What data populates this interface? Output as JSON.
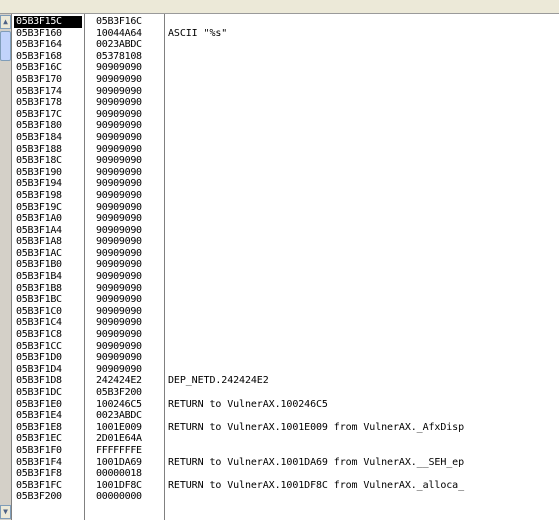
{
  "stack": {
    "rows": [
      {
        "addr": "05B3F15C",
        "val": "05B3F16C",
        "comment": "",
        "selected": true
      },
      {
        "addr": "05B3F160",
        "val": "10044A64",
        "comment": "ASCII \"%s\""
      },
      {
        "addr": "05B3F164",
        "val": "0023ABDC",
        "comment": ""
      },
      {
        "addr": "05B3F168",
        "val": "05378108",
        "comment": ""
      },
      {
        "addr": "05B3F16C",
        "val": "90909090",
        "comment": ""
      },
      {
        "addr": "05B3F170",
        "val": "90909090",
        "comment": ""
      },
      {
        "addr": "05B3F174",
        "val": "90909090",
        "comment": ""
      },
      {
        "addr": "05B3F178",
        "val": "90909090",
        "comment": ""
      },
      {
        "addr": "05B3F17C",
        "val": "90909090",
        "comment": ""
      },
      {
        "addr": "05B3F180",
        "val": "90909090",
        "comment": ""
      },
      {
        "addr": "05B3F184",
        "val": "90909090",
        "comment": ""
      },
      {
        "addr": "05B3F188",
        "val": "90909090",
        "comment": ""
      },
      {
        "addr": "05B3F18C",
        "val": "90909090",
        "comment": ""
      },
      {
        "addr": "05B3F190",
        "val": "90909090",
        "comment": ""
      },
      {
        "addr": "05B3F194",
        "val": "90909090",
        "comment": ""
      },
      {
        "addr": "05B3F198",
        "val": "90909090",
        "comment": ""
      },
      {
        "addr": "05B3F19C",
        "val": "90909090",
        "comment": ""
      },
      {
        "addr": "05B3F1A0",
        "val": "90909090",
        "comment": ""
      },
      {
        "addr": "05B3F1A4",
        "val": "90909090",
        "comment": ""
      },
      {
        "addr": "05B3F1A8",
        "val": "90909090",
        "comment": ""
      },
      {
        "addr": "05B3F1AC",
        "val": "90909090",
        "comment": ""
      },
      {
        "addr": "05B3F1B0",
        "val": "90909090",
        "comment": ""
      },
      {
        "addr": "05B3F1B4",
        "val": "90909090",
        "comment": ""
      },
      {
        "addr": "05B3F1B8",
        "val": "90909090",
        "comment": ""
      },
      {
        "addr": "05B3F1BC",
        "val": "90909090",
        "comment": ""
      },
      {
        "addr": "05B3F1C0",
        "val": "90909090",
        "comment": ""
      },
      {
        "addr": "05B3F1C4",
        "val": "90909090",
        "comment": ""
      },
      {
        "addr": "05B3F1C8",
        "val": "90909090",
        "comment": ""
      },
      {
        "addr": "05B3F1CC",
        "val": "90909090",
        "comment": ""
      },
      {
        "addr": "05B3F1D0",
        "val": "90909090",
        "comment": ""
      },
      {
        "addr": "05B3F1D4",
        "val": "90909090",
        "comment": ""
      },
      {
        "addr": "05B3F1D8",
        "val": "242424E2",
        "comment": "DEP_NETD.242424E2"
      },
      {
        "addr": "05B3F1DC",
        "val": "05B3F200",
        "comment": ""
      },
      {
        "addr": "05B3F1E0",
        "val": "100246C5",
        "comment": "RETURN to VulnerAX.100246C5"
      },
      {
        "addr": "05B3F1E4",
        "val": "0023ABDC",
        "comment": ""
      },
      {
        "addr": "05B3F1E8",
        "val": "1001E009",
        "comment": "RETURN to VulnerAX.1001E009 from VulnerAX._AfxDisp"
      },
      {
        "addr": "05B3F1EC",
        "val": "2D01E64A",
        "comment": ""
      },
      {
        "addr": "05B3F1F0",
        "val": "FFFFFFFE",
        "comment": ""
      },
      {
        "addr": "05B3F1F4",
        "val": "1001DA69",
        "comment": "RETURN to VulnerAX.1001DA69 from VulnerAX.__SEH_ep"
      },
      {
        "addr": "05B3F1F8",
        "val": "00000018",
        "comment": ""
      },
      {
        "addr": "05B3F1FC",
        "val": "1001DF8C",
        "comment": "RETURN to VulnerAX.1001DF8C from VulnerAX._alloca_"
      },
      {
        "addr": "05B3F200",
        "val": "00000000",
        "comment": ""
      }
    ]
  },
  "colors": {
    "background": "#ffffff",
    "selection": "#000000",
    "separator": "#808080"
  },
  "icons": {
    "scroll_up": "triangle-up-icon",
    "scroll_down": "triangle-down-icon"
  }
}
